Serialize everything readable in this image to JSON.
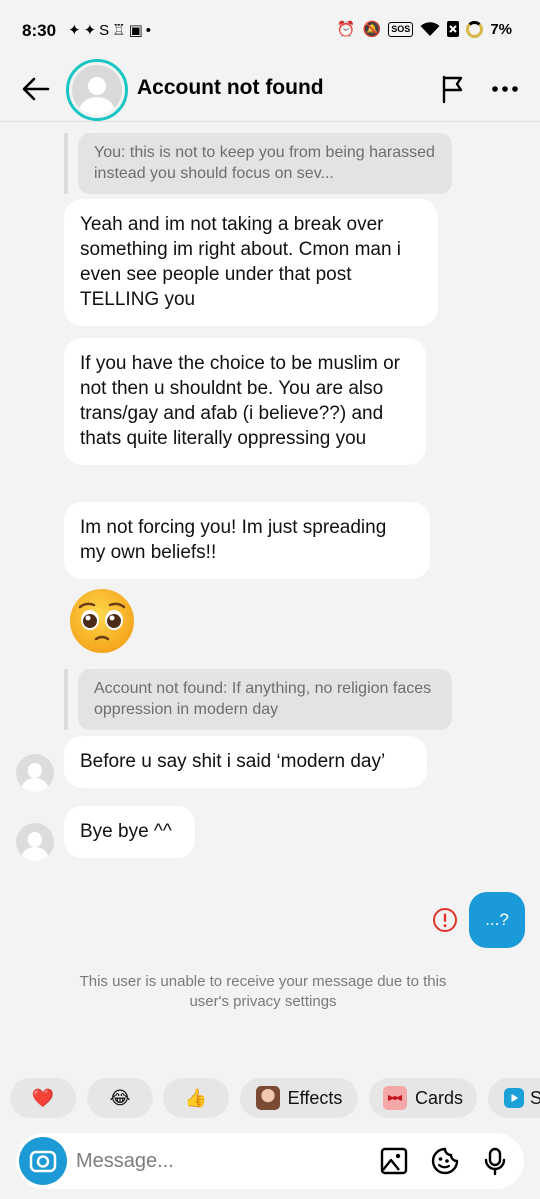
{
  "status_bar": {
    "time": "8:30",
    "left_icons": "✦✦S♖▣•",
    "sos": "SOS",
    "battery": "7%"
  },
  "header": {
    "title": "Account not found",
    "ring_color": "#19c6c4"
  },
  "messages": [
    {
      "kind": "quote",
      "text": "You: this is not to keep you from being harassed instead you should focus on sev..."
    },
    {
      "kind": "received",
      "text": "Yeah and im not taking a break over something im right about. Cmon man i even see people under that post TELLING you"
    },
    {
      "kind": "received",
      "text": "If you have the choice to be muslim or not then u shouldnt be. You are also trans/gay and afab (i believe??) and thats quite literally oppressing you"
    },
    {
      "kind": "received",
      "text": "Im not forcing you! Im just spreading my own beliefs!!"
    },
    {
      "kind": "emoji",
      "emoji": "pleading-face"
    },
    {
      "kind": "quote",
      "text": "Account not found: If anything, no religion faces oppression in modern day"
    },
    {
      "kind": "received",
      "text": "Before u say shit i said ‘modern day’"
    },
    {
      "kind": "received",
      "text": "Bye bye ^^"
    }
  ],
  "sent": {
    "text": "...?",
    "color": "#1a9ad8"
  },
  "privacy_note": "This user is unable to receive your message due to this user's privacy settings",
  "quick_reactions": [
    {
      "icon": "heart",
      "glyph": "❤️"
    },
    {
      "icon": "laughing",
      "glyph": "😂"
    },
    {
      "icon": "thumbs-up",
      "glyph": "👍"
    },
    {
      "icon": "effects-thumbnail",
      "label": "Effects"
    },
    {
      "icon": "cards-thumbnail",
      "label": "Cards"
    },
    {
      "icon": "play-thumbnail",
      "label": "S"
    }
  ],
  "composer": {
    "placeholder": "Message..."
  }
}
